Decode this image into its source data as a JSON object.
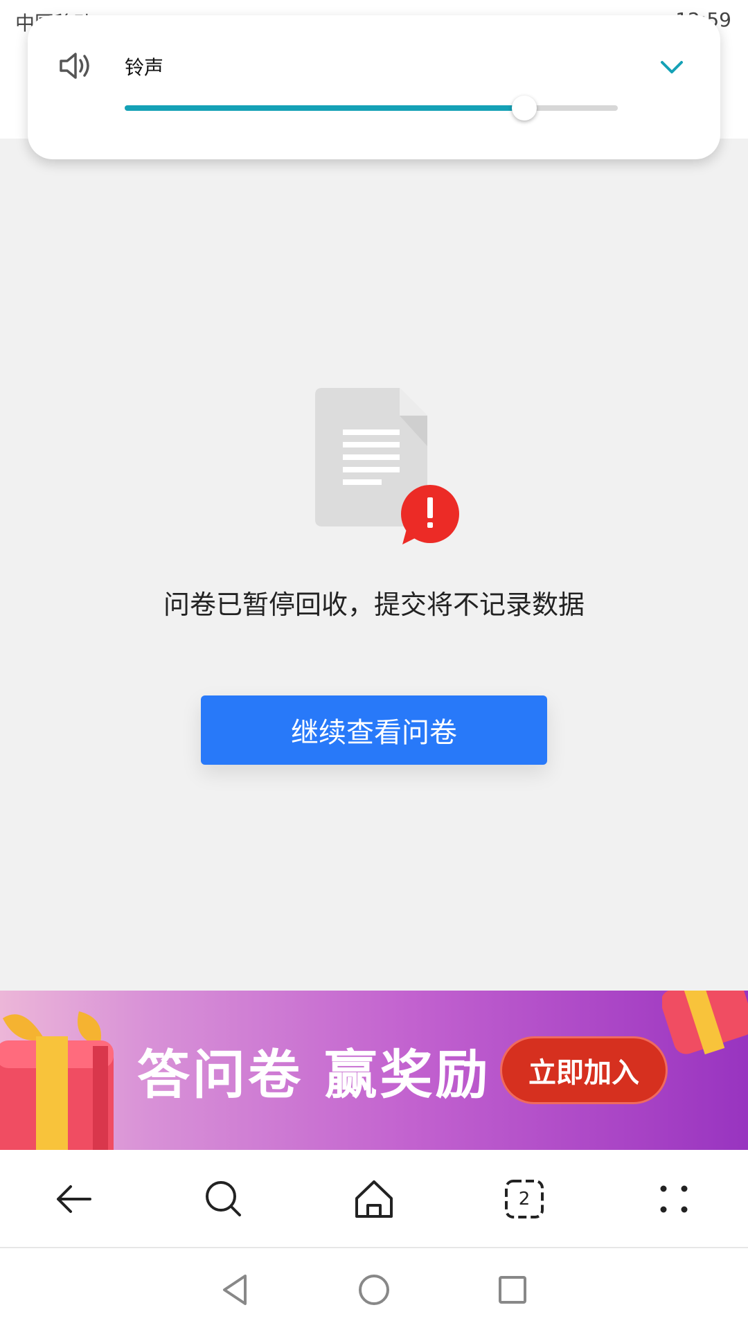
{
  "status_bar": {
    "carrier_text": "中国移动",
    "time_text": "12:59"
  },
  "volume_panel": {
    "label": "铃声",
    "level_fraction": 0.81,
    "accent_color": "#15a1b6",
    "icons": {
      "speaker": "speaker-icon",
      "collapse": "chevron-down-icon"
    }
  },
  "main": {
    "illustration_icon": "document-alert-icon",
    "message": "问卷已暂停回收，提交将不记录数据",
    "continue_button_label": "继续查看问卷",
    "button_color": "#2879f9"
  },
  "banner": {
    "headline": "答问卷 赢奖励",
    "join_button_label": "立即加入",
    "icons": [
      "gift-icon"
    ]
  },
  "browser_toolbar": {
    "tab_count": "2",
    "icons": [
      "back-arrow-icon",
      "search-icon",
      "home-icon",
      "tabs-icon",
      "menu-dots-icon"
    ]
  },
  "system_nav": {
    "icons": [
      "nav-back-icon",
      "nav-home-icon",
      "nav-recents-icon"
    ]
  }
}
